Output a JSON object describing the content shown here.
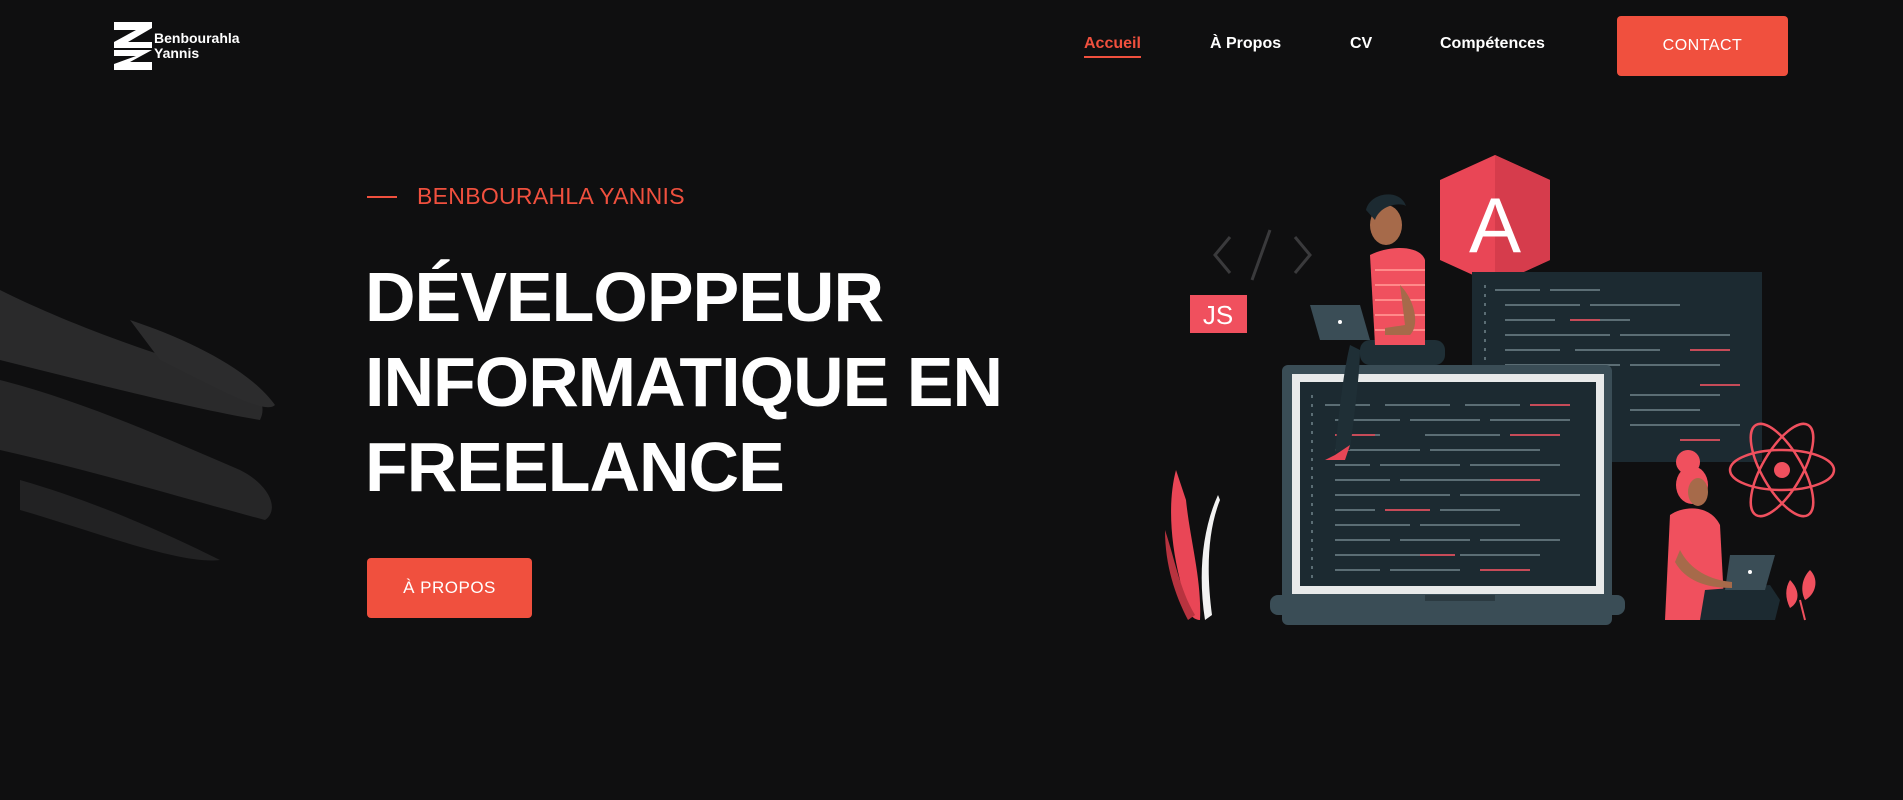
{
  "brand": {
    "name_line1": "Benbourahla",
    "name_line2": "Yannis"
  },
  "nav": {
    "items": [
      {
        "label": "Accueil",
        "active": true
      },
      {
        "label": "À Propos",
        "active": false
      },
      {
        "label": "CV",
        "active": false
      },
      {
        "label": "Compétences",
        "active": false
      }
    ],
    "contact_label": "CONTACT"
  },
  "hero": {
    "eyebrow": "BENBOURAHLA YANNIS",
    "title_line1": "DÉVELOPPEUR",
    "title_line2": "INFORMATIQUE EN",
    "title_line3": "FREELANCE",
    "button_label": "À PROPOS"
  },
  "illustration": {
    "js_badge": "JS",
    "angular_letter": "A"
  },
  "colors": {
    "accent": "#f0503e",
    "background": "#0f0f10",
    "screen": "#1c2a31",
    "laptop_frame": "#3a4d56"
  }
}
